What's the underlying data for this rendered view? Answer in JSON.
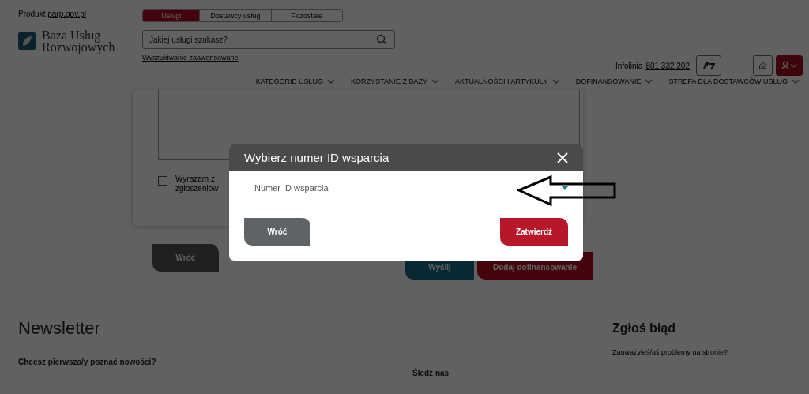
{
  "header": {
    "product_label": "Produkt",
    "product_link": "parp.gov.pl",
    "logo_lines": [
      "Baza Usług",
      "Rozwojowych"
    ],
    "search_tabs": [
      {
        "label": "Usługi",
        "selected": true
      },
      {
        "label": "Dostawcy usług",
        "selected": false
      },
      {
        "label": "Pozostałe",
        "selected": false
      }
    ],
    "search": {
      "placeholder": "Jakiej usługi szukasz?"
    },
    "advanced_search_link": "Wyszukiwanie zaawansowane",
    "hotline_label": "Infolinia",
    "hotline_number": "801 332 202"
  },
  "nav": [
    "KATEGORIE USŁUG",
    "KORZYSTANIE Z BAZY",
    "AKTUALNOŚCI I ARTYKUŁY",
    "DOFINANSOWANIE",
    "STREFA DLA DOSTAWCÓW USŁUG"
  ],
  "form": {
    "consent": {
      "checked": false,
      "lines": [
        "Wyrazam z",
        "zgłoszeniow"
      ]
    },
    "buttons": [
      {
        "label": "Wróć",
        "kind": "back"
      },
      {
        "label": "Wyślij",
        "kind": "send"
      },
      {
        "label": "Dodaj dofinansowanie",
        "kind": "primary"
      }
    ]
  },
  "modal": {
    "title": "Wybierz numer ID wsparcia",
    "select": {
      "placeholder": "Numer ID wsparcia"
    },
    "buttons": [
      {
        "label": "Wróć",
        "kind": "secondary"
      },
      {
        "label": "Zatwierdź",
        "kind": "primary"
      }
    ]
  },
  "footer": {
    "newsletter_title": "Newsletter",
    "newsletter_prompt": "Chcesz pierwsza/y poznać nowości?",
    "follow_label": "Śledź nas",
    "report_title": "Zgłoś błąd",
    "report_prompt": "Zauważyłeś/aś problemy na stronie?"
  }
}
